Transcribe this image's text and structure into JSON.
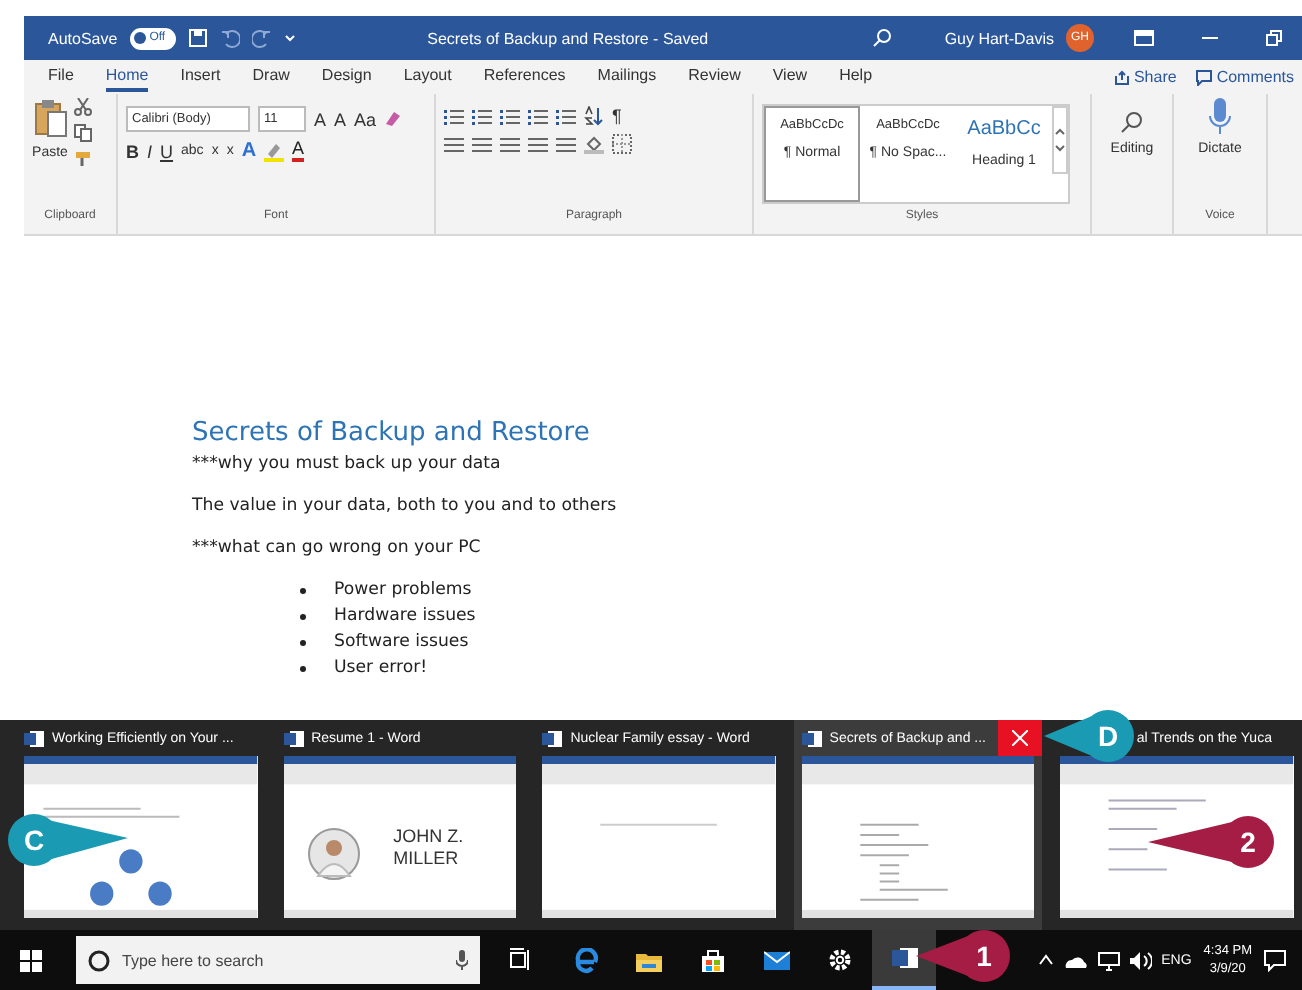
{
  "title_bar": {
    "autosave_label": "AutoSave",
    "autosave_toggle": {
      "label": "Off",
      "on": false
    },
    "document_title": "Secrets of Backup and Restore - Saved",
    "user_name": "Guy Hart-Davis",
    "user_initials": "GH"
  },
  "menu_tabs": [
    {
      "label": "File",
      "selected": false
    },
    {
      "label": "Home",
      "selected": true
    },
    {
      "label": "Insert",
      "selected": false
    },
    {
      "label": "Draw",
      "selected": false
    },
    {
      "label": "Design",
      "selected": false
    },
    {
      "label": "Layout",
      "selected": false
    },
    {
      "label": "References",
      "selected": false
    },
    {
      "label": "Mailings",
      "selected": false
    },
    {
      "label": "Review",
      "selected": false
    },
    {
      "label": "View",
      "selected": false
    },
    {
      "label": "Help",
      "selected": false
    }
  ],
  "share_button": "Share",
  "comments_button": "Comments",
  "ribbon": {
    "clipboard": {
      "paste": "Paste",
      "label": "Clipboard"
    },
    "font": {
      "name": "Calibri (Body)",
      "size": "11",
      "size_buttons": [
        "A",
        "A"
      ],
      "case_button": "Aa",
      "format_buttons": [
        "B",
        "I",
        "U",
        "abc",
        "x",
        "x"
      ],
      "effects_button": "A",
      "color_button": "A",
      "label": "Font"
    },
    "paragraph": {
      "marks_button": "¶",
      "label": "Paragraph"
    },
    "styles": {
      "items": [
        {
          "sample": "AaBbCcDc",
          "name": "¶ Normal",
          "kind": "body",
          "selected": true
        },
        {
          "sample": "AaBbCcDc",
          "name": "¶ No Spac...",
          "kind": "body",
          "selected": false
        },
        {
          "sample": "AaBbCc",
          "name": "Heading 1",
          "kind": "heading",
          "selected": false
        }
      ],
      "label": "Styles"
    },
    "editing": {
      "label": "Editing"
    },
    "voice": {
      "button": "Dictate",
      "label": "Voice"
    }
  },
  "document": {
    "heading": "Secrets of Backup and Restore",
    "paragraphs": [
      {
        "kind": "paragraph",
        "text": "***why you must back up your data"
      },
      {
        "kind": "paragraph",
        "text": "The value in your data, both to you and to others"
      },
      {
        "kind": "paragraph",
        "text": "***what can go wrong on your PC"
      },
      {
        "kind": "bullet",
        "text": "Power problems"
      },
      {
        "kind": "bullet",
        "text": "Hardware issues"
      },
      {
        "kind": "bullet",
        "text": "Software issues"
      },
      {
        "kind": "bullet",
        "text": "User error!"
      }
    ]
  },
  "thumbnails": [
    {
      "title": "Working Efficiently on Your ...",
      "kind": "diagram",
      "selected": false
    },
    {
      "title": "Resume 1 - Word",
      "kind": "resume",
      "selected": false,
      "name_lines": [
        "JOHN Z.",
        "MILLER"
      ]
    },
    {
      "title": "Nuclear Family essay - Word",
      "kind": "blank",
      "selected": false
    },
    {
      "title": "Secrets of Backup and ...",
      "kind": "outline",
      "selected": true
    },
    {
      "title": "al Trends on the Yuca",
      "kind": "list",
      "selected": false
    }
  ],
  "taskbar": {
    "search_placeholder": "Type here to search",
    "word_button": {
      "selected": true
    },
    "language": "ENG",
    "time": "4:34 PM",
    "date": "3/9/20"
  },
  "callouts": [
    {
      "label": "C",
      "color": "#1b9ab4"
    },
    {
      "label": "D",
      "color": "#1b9ab4"
    },
    {
      "label": "1",
      "color": "#a51c45"
    },
    {
      "label": "2",
      "color": "#a51c45"
    }
  ]
}
